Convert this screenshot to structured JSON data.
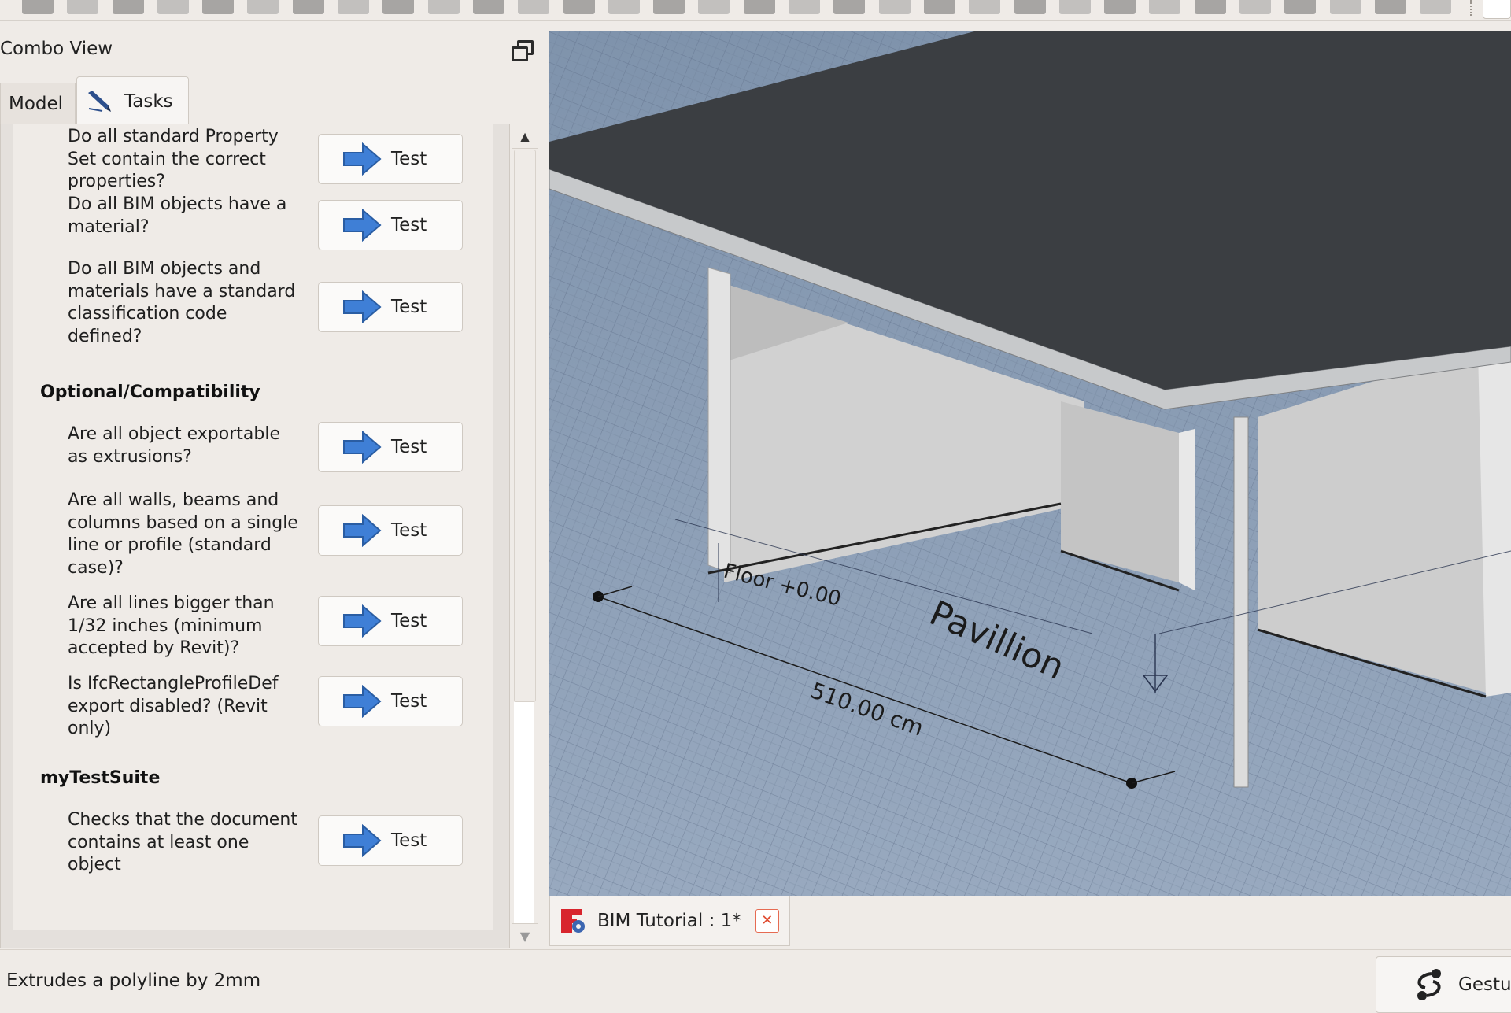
{
  "combo_view": {
    "title": "Combo View",
    "tabs": {
      "model": "Model",
      "tasks": "Tasks"
    }
  },
  "test_groups": [
    {
      "header": "",
      "items": [
        {
          "question": "Do all standard Property Set contain the correct properties?",
          "button": "Test"
        },
        {
          "question": "Do all BIM objects have a material?",
          "button": "Test"
        },
        {
          "question": "Do all BIM objects and materials have a standard classification code defined?",
          "button": "Test"
        }
      ]
    },
    {
      "header": "Optional/Compatibility",
      "items": [
        {
          "question": "Are all object exportable as extrusions?",
          "button": "Test"
        },
        {
          "question": "Are all walls, beams and columns based on a single line or profile (standard case)?",
          "button": "Test"
        },
        {
          "question": "Are all lines bigger than 1/32 inches (minimum accepted by Revit)?",
          "button": "Test"
        },
        {
          "question": "Is IfcRectangleProfileDef export disabled? (Revit only)",
          "button": "Test"
        }
      ]
    },
    {
      "header": "myTestSuite",
      "items": [
        {
          "question": "Checks that the document contains at least one object",
          "button": "Test"
        }
      ]
    }
  ],
  "viewport": {
    "floor_label": "Floor +0.00",
    "building_label": "Pavillion",
    "dimension_label": "510.00 cm"
  },
  "document_tab": {
    "title": "BIM Tutorial : 1*",
    "close_glyph": "✕"
  },
  "status_bar": {
    "message": "Extrudes a polyline by 2mm",
    "navigation_style": "Gestur"
  },
  "icons": {
    "test_arrow": "arrow-right-icon",
    "tasks_tab": "pencil-icon",
    "document": "freecad-document-icon",
    "navigation": "gesture-navigation-icon"
  },
  "colors": {
    "arrow_blue": "#3f7fd6",
    "close_red": "#e04a2e",
    "ground": "#8c9eb6",
    "slab": "#3b3e42"
  }
}
